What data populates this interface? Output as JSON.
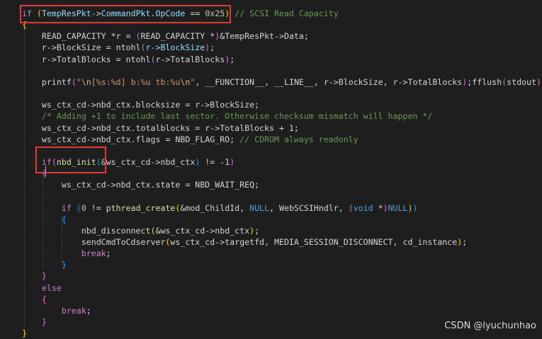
{
  "colors": {
    "background": "#1e1e1e",
    "keyword": "#c586c0",
    "variable": "#9cdcfe",
    "function": "#dcdcaa",
    "number": "#b5cea8",
    "string": "#ce9178",
    "escape": "#d7ba7d",
    "comment": "#6a9955",
    "type": "#4ec9b0",
    "macro": "#569cd6",
    "punct": "#d4d4d4",
    "bracket1": "#ffd700",
    "bracket2": "#da70d6",
    "bracket3": "#179fff",
    "highlight": "#e53935"
  },
  "lines": [
    [
      [
        "if",
        "keyword"
      ],
      [
        " ",
        "p"
      ],
      [
        "(",
        "bracket1"
      ],
      [
        "TempResPkt",
        "variable"
      ],
      [
        "->",
        "p"
      ],
      [
        "CommandPkt",
        "variable"
      ],
      [
        ".",
        "p"
      ],
      [
        "OpCode",
        "variable"
      ],
      [
        " == ",
        "p"
      ],
      [
        "0x25",
        "number"
      ],
      [
        ")",
        "bracket1"
      ],
      [
        " ",
        "p"
      ],
      [
        "// SCSI Read Capacity",
        "comment"
      ]
    ],
    [
      [
        "{",
        "bracket1"
      ]
    ],
    [
      [
        "    READ_CAPACITY *r = ",
        "p"
      ],
      [
        "(",
        "bracket2"
      ],
      [
        "READ_CAPACITY *",
        "p"
      ],
      [
        ")",
        "bracket2"
      ],
      [
        "&TempResPkt->Data;",
        "p"
      ]
    ],
    [
      [
        "    r->BlockSize = ntohl",
        "p"
      ],
      [
        "(",
        "bracket2"
      ],
      [
        "r->BlockSize",
        "variable"
      ],
      [
        ")",
        "bracket2"
      ],
      [
        ";",
        "p"
      ]
    ],
    [
      [
        "    r->TotalBlocks = ntohl",
        "p"
      ],
      [
        "(",
        "bracket2"
      ],
      [
        "r->TotalBlocks",
        "p"
      ],
      [
        ")",
        "bracket2"
      ],
      [
        ";",
        "p"
      ]
    ],
    [],
    [
      [
        "    printf",
        "p"
      ],
      [
        "(",
        "bracket2"
      ],
      [
        "\"",
        "string"
      ],
      [
        "\\n",
        "escape"
      ],
      [
        "[%s:%d] b:%u tb:%u",
        "string"
      ],
      [
        "\\n",
        "escape"
      ],
      [
        "\"",
        "string"
      ],
      [
        ", __FUNCTION__, __LINE__, r->BlockSize, r->TotalBlocks",
        "p"
      ],
      [
        ")",
        "bracket2"
      ],
      [
        ";fflush",
        "p"
      ],
      [
        "(",
        "bracket2"
      ],
      [
        "stdout",
        "p"
      ],
      [
        ")",
        "bracket2"
      ],
      [
        ";",
        "p"
      ]
    ],
    [],
    [
      [
        "    ws_ctx_cd->nbd_ctx.blocksize = r->BlockSize;",
        "p"
      ]
    ],
    [
      [
        "    /* Adding +1 to include last sector. Otherwise checksum mismatch will happen */",
        "comment"
      ]
    ],
    [
      [
        "    ws_ctx_cd->nbd_ctx.totalblocks = r->TotalBlocks + 1;",
        "p"
      ]
    ],
    [
      [
        "    ws_ctx_cd->nbd_ctx.flags = NBD_FLAG_RO; ",
        "p"
      ],
      [
        "// CDROM always readonly",
        "comment"
      ]
    ],
    [],
    [
      [
        "    ",
        "p"
      ],
      [
        "if",
        "keyword"
      ],
      [
        "(",
        "bracket2"
      ],
      [
        "nbd_init",
        "function"
      ],
      [
        "(",
        "bracket3"
      ],
      [
        "&ws_ctx_cd->nbd_ctx",
        "p"
      ],
      [
        ")",
        "bracket3"
      ],
      [
        " != -1",
        "p"
      ],
      [
        ")",
        "bracket2"
      ]
    ],
    [
      [
        "    ",
        "p"
      ],
      [
        "{",
        "bracket2"
      ]
    ],
    [
      [
        "        ws_ctx_cd->nbd_ctx.state = NBD_WAIT_REQ;",
        "p"
      ]
    ],
    [],
    [
      [
        "        ",
        "p"
      ],
      [
        "if",
        "keyword"
      ],
      [
        " ",
        "p"
      ],
      [
        "(",
        "bracket3"
      ],
      [
        "0",
        "number"
      ],
      [
        " != ",
        "p"
      ],
      [
        "pthread_create",
        "function"
      ],
      [
        "(",
        "bracket1"
      ],
      [
        "&mod_ChildId, ",
        "p"
      ],
      [
        "NULL",
        "macro"
      ],
      [
        ", WebSCSIHndlr, ",
        "p"
      ],
      [
        "(",
        "bracket2"
      ],
      [
        "void",
        "macro"
      ],
      [
        " *",
        "p"
      ],
      [
        ")",
        "bracket2"
      ],
      [
        "NULL",
        "macro"
      ],
      [
        ")",
        "bracket1"
      ],
      [
        ")",
        "bracket3"
      ]
    ],
    [
      [
        "        ",
        "p"
      ],
      [
        "{",
        "bracket3"
      ]
    ],
    [
      [
        "            nbd_disconnect",
        "p"
      ],
      [
        "(",
        "bracket1"
      ],
      [
        "&ws_ctx_cd->nbd_ctx",
        "p"
      ],
      [
        ")",
        "bracket1"
      ],
      [
        ";",
        "p"
      ]
    ],
    [
      [
        "            sendCmdToCdserver",
        "p"
      ],
      [
        "(",
        "bracket1"
      ],
      [
        "ws_ctx_cd->targetfd, MEDIA_SESSION_DISCONNECT, cd_instance",
        "p"
      ],
      [
        ")",
        "bracket1"
      ],
      [
        ";",
        "p"
      ]
    ],
    [
      [
        "            break",
        "keyword"
      ],
      [
        ";",
        "p"
      ]
    ],
    [
      [
        "        ",
        "p"
      ],
      [
        "}",
        "bracket3"
      ]
    ],
    [
      [
        "    ",
        "p"
      ],
      [
        "}",
        "bracket2"
      ]
    ],
    [
      [
        "    else",
        "keyword"
      ]
    ],
    [
      [
        "    ",
        "p"
      ],
      [
        "{",
        "bracket2"
      ]
    ],
    [
      [
        "        break",
        "keyword"
      ],
      [
        ";",
        "p"
      ]
    ],
    [
      [
        "    ",
        "p"
      ],
      [
        "}",
        "bracket2"
      ]
    ],
    [
      [
        "}",
        "bracket1"
      ]
    ]
  ],
  "watermark": "CSDN @lyuchunhao"
}
